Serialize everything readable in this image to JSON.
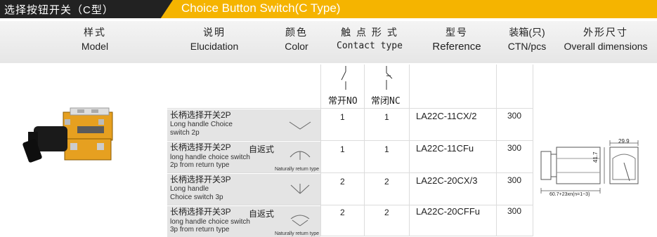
{
  "title": {
    "cn": "选择按钮开关（C型）",
    "en": "Choice Button Switch(C Type)"
  },
  "headers": {
    "model": {
      "cn": "样式",
      "en": "Model"
    },
    "elucidation": {
      "cn": "说明",
      "en": "Elucidation"
    },
    "color": {
      "cn": "颜色",
      "en": "Color"
    },
    "contact": {
      "cn": "触 点 形 式",
      "en": "Contact type"
    },
    "reference": {
      "cn": "型号",
      "en": "Reference"
    },
    "ctn": {
      "cn": "装箱(只)",
      "en": "CTN/pcs"
    },
    "dims": {
      "cn": "外形尺寸",
      "en": "Overall dimensions"
    }
  },
  "contacts": {
    "no": "常开NO",
    "nc": "常闭NC"
  },
  "rows": [
    {
      "desc_cn": "长柄选择开关2P",
      "desc_en1": "Long handle Choice",
      "desc_en2": "switch 2p",
      "self_return": "",
      "note": "",
      "no": "1",
      "nc": "1",
      "reference": "LA22C-11CX/2",
      "ctn": "300"
    },
    {
      "desc_cn": "长柄选择开关2P",
      "desc_en1": "long handle choice switch",
      "desc_en2": "2p from return type",
      "self_return": "自返式",
      "note": "Naturally return type",
      "no": "1",
      "nc": "1",
      "reference": "LA22C-11CFu",
      "ctn": "300"
    },
    {
      "desc_cn": "长柄选择开关3P",
      "desc_en1": "Long handle",
      "desc_en2": "Choice switch 3p",
      "self_return": "",
      "note": "",
      "no": "2",
      "nc": "2",
      "reference": "LA22C-20CX/3",
      "ctn": "300"
    },
    {
      "desc_cn": "长柄选择开关3P",
      "desc_en1": "long handle choice switch",
      "desc_en2": "3p from return type",
      "self_return": "自返式",
      "note": "Naturally return type",
      "no": "2",
      "nc": "2",
      "reference": "LA22C-20CFFu",
      "ctn": "300"
    }
  ],
  "dimensions": {
    "width": "29.9",
    "height": "41.7",
    "length": "60.7+23xn(n=1~3)"
  }
}
